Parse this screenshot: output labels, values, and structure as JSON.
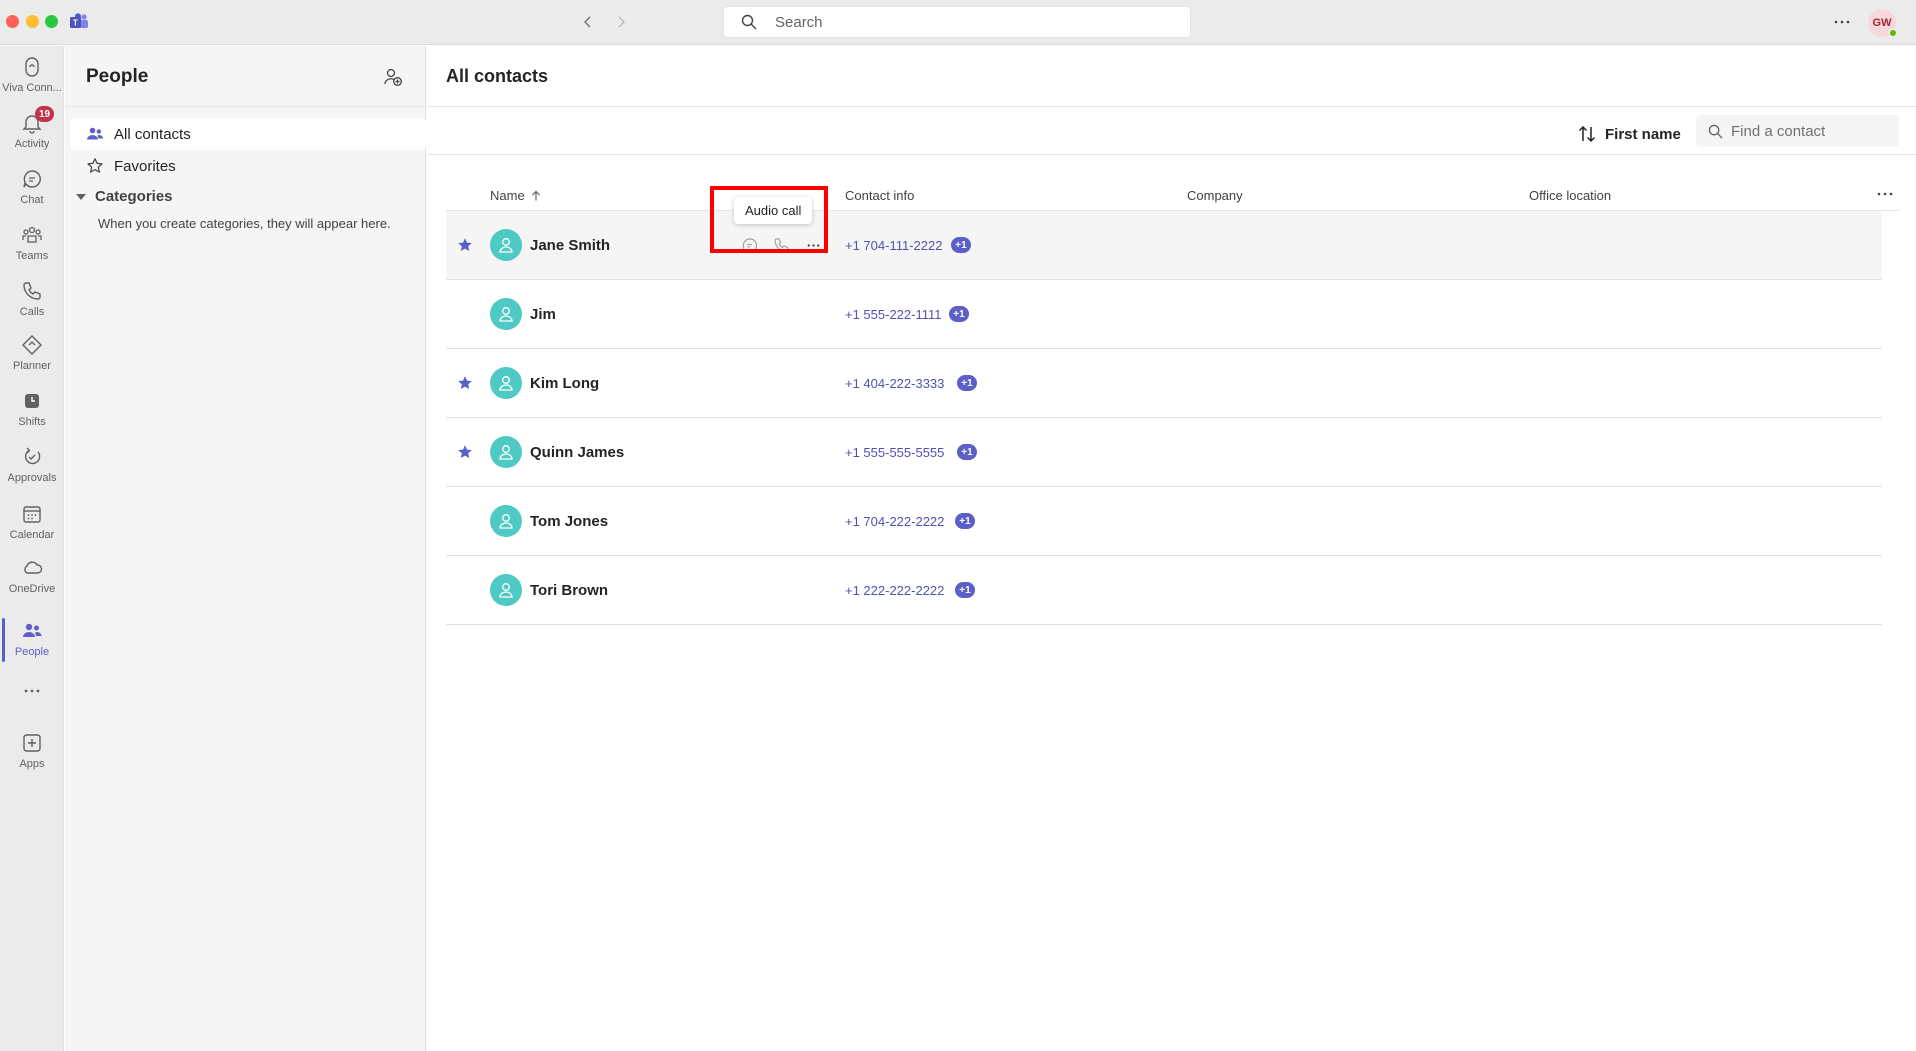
{
  "titlebar": {
    "search_placeholder": "Search",
    "user_initials": "GW"
  },
  "rail": {
    "items": [
      {
        "label": "Viva Conn...",
        "icon": "viva-connections-icon"
      },
      {
        "label": "Activity",
        "icon": "bell-icon",
        "badge": "19"
      },
      {
        "label": "Chat",
        "icon": "chat-icon"
      },
      {
        "label": "Teams",
        "icon": "teams-icon"
      },
      {
        "label": "Calls",
        "icon": "phone-icon"
      },
      {
        "label": "Planner",
        "icon": "planner-icon"
      },
      {
        "label": "Shifts",
        "icon": "clock-icon"
      },
      {
        "label": "Approvals",
        "icon": "approvals-icon"
      },
      {
        "label": "Calendar",
        "icon": "calendar-icon"
      },
      {
        "label": "OneDrive",
        "icon": "cloud-icon"
      },
      {
        "label": "People",
        "icon": "people-icon",
        "active": true
      },
      {
        "label": "Apps",
        "icon": "apps-icon"
      }
    ]
  },
  "leftpane": {
    "title": "People",
    "items": [
      {
        "label": "All contacts",
        "selected": true
      },
      {
        "label": "Favorites"
      }
    ],
    "categories_label": "Categories",
    "categories_hint": "When you create categories, they will appear here."
  },
  "main": {
    "title": "All contacts",
    "sort_label": "First name",
    "find_placeholder": "Find a contact",
    "columns": {
      "name": "Name",
      "contact": "Contact info",
      "company": "Company",
      "office": "Office location"
    },
    "tooltip": "Audio call",
    "contacts": [
      {
        "name": "Jane Smith",
        "phone": "+1 704-111-2222",
        "extra": "+1",
        "favorite": true
      },
      {
        "name": "Jim",
        "phone": "+1 555-222-1111",
        "extra": "+1",
        "favorite": false
      },
      {
        "name": "Kim Long",
        "phone": "+1 404-222-3333",
        "extra": "+1",
        "favorite": true
      },
      {
        "name": "Quinn James",
        "phone": "+1 555-555-5555",
        "extra": "+1",
        "favorite": true
      },
      {
        "name": "Tom Jones",
        "phone": "+1 704-222-2222",
        "extra": "+1",
        "favorite": false
      },
      {
        "name": "Tori Brown",
        "phone": "+1 222-222-2222",
        "extra": "+1",
        "favorite": false
      }
    ]
  },
  "colors": {
    "accent": "#5b5fc7",
    "avatar_teal": "#4fc9c3",
    "link": "#4f52b2",
    "badge_red": "#c4314b",
    "highlight_red": "#ff0000"
  }
}
